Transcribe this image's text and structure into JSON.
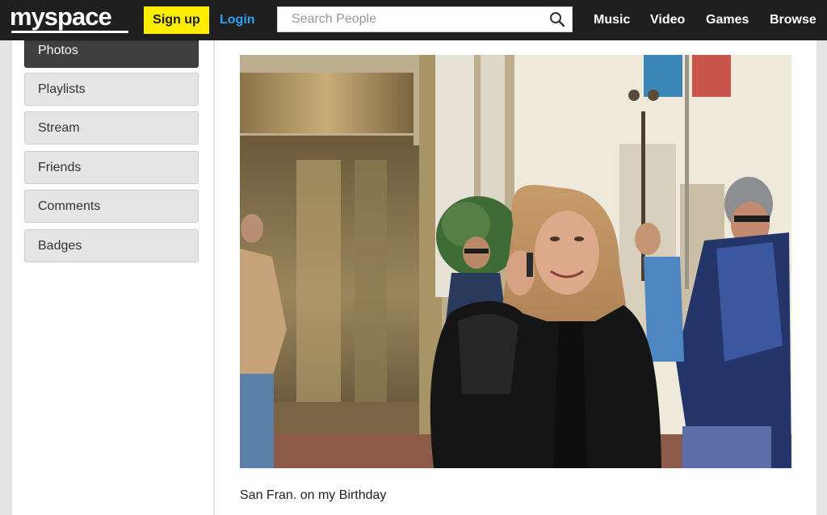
{
  "header": {
    "logo": "myspace",
    "signup_label": "Sign up",
    "login_label": "Login",
    "search_placeholder": "Search People",
    "nav": [
      "Music",
      "Video",
      "Games",
      "Browse"
    ]
  },
  "sidebar": {
    "items": [
      {
        "label": "Photos",
        "active": true
      },
      {
        "label": "Playlists"
      },
      {
        "label": "Stream"
      },
      {
        "label": "Friends"
      },
      {
        "label": "Comments"
      },
      {
        "label": "Badges"
      }
    ]
  },
  "photo": {
    "caption": "San Fran. on my Birthday"
  },
  "colors": {
    "topbar": "#1f1f1f",
    "signup": "#ffed00",
    "login": "#2da1f5",
    "active_tab": "#3f3f3f"
  }
}
